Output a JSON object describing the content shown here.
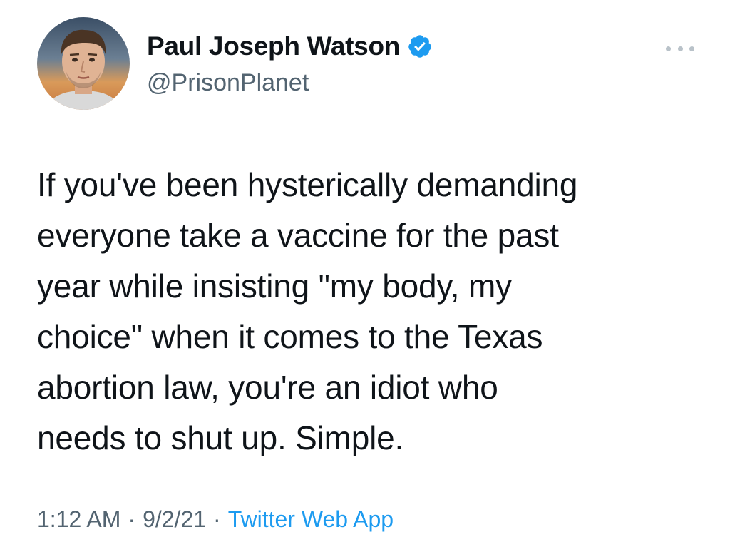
{
  "author": {
    "display_name": "Paul Joseph Watson",
    "handle": "@PrisonPlanet",
    "verified_icon": "verified-badge-icon",
    "avatar_icon": "avatar"
  },
  "more_icon": "more-options-icon",
  "tweet": {
    "text": "If you've been hysterically demanding\neveryone take a vaccine for the past\nyear while insisting \"my body, my\nchoice\" when it comes to the Texas\nabortion law, you're an idiot who\nneeds to shut up. Simple.",
    "time": "1:12 AM",
    "date": "9/2/21",
    "separator": "·",
    "source": "Twitter Web App"
  },
  "colors": {
    "accent": "#1d9bf0",
    "text": "#0f1419",
    "muted": "#536471"
  }
}
